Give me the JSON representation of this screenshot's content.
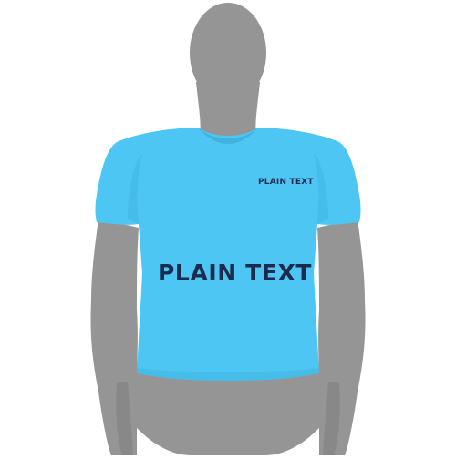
{
  "colors": {
    "background": "#ffffff",
    "mannequin": "#959595",
    "mannequin_shadow": "#7d7d7d",
    "shirt": "#4dc6f3",
    "shirt_shadow": "#3fb2de",
    "print": "#1b2a4d"
  },
  "logos": {
    "chest": "PLAIN TEXT",
    "front": "PLAIN TEXT"
  }
}
